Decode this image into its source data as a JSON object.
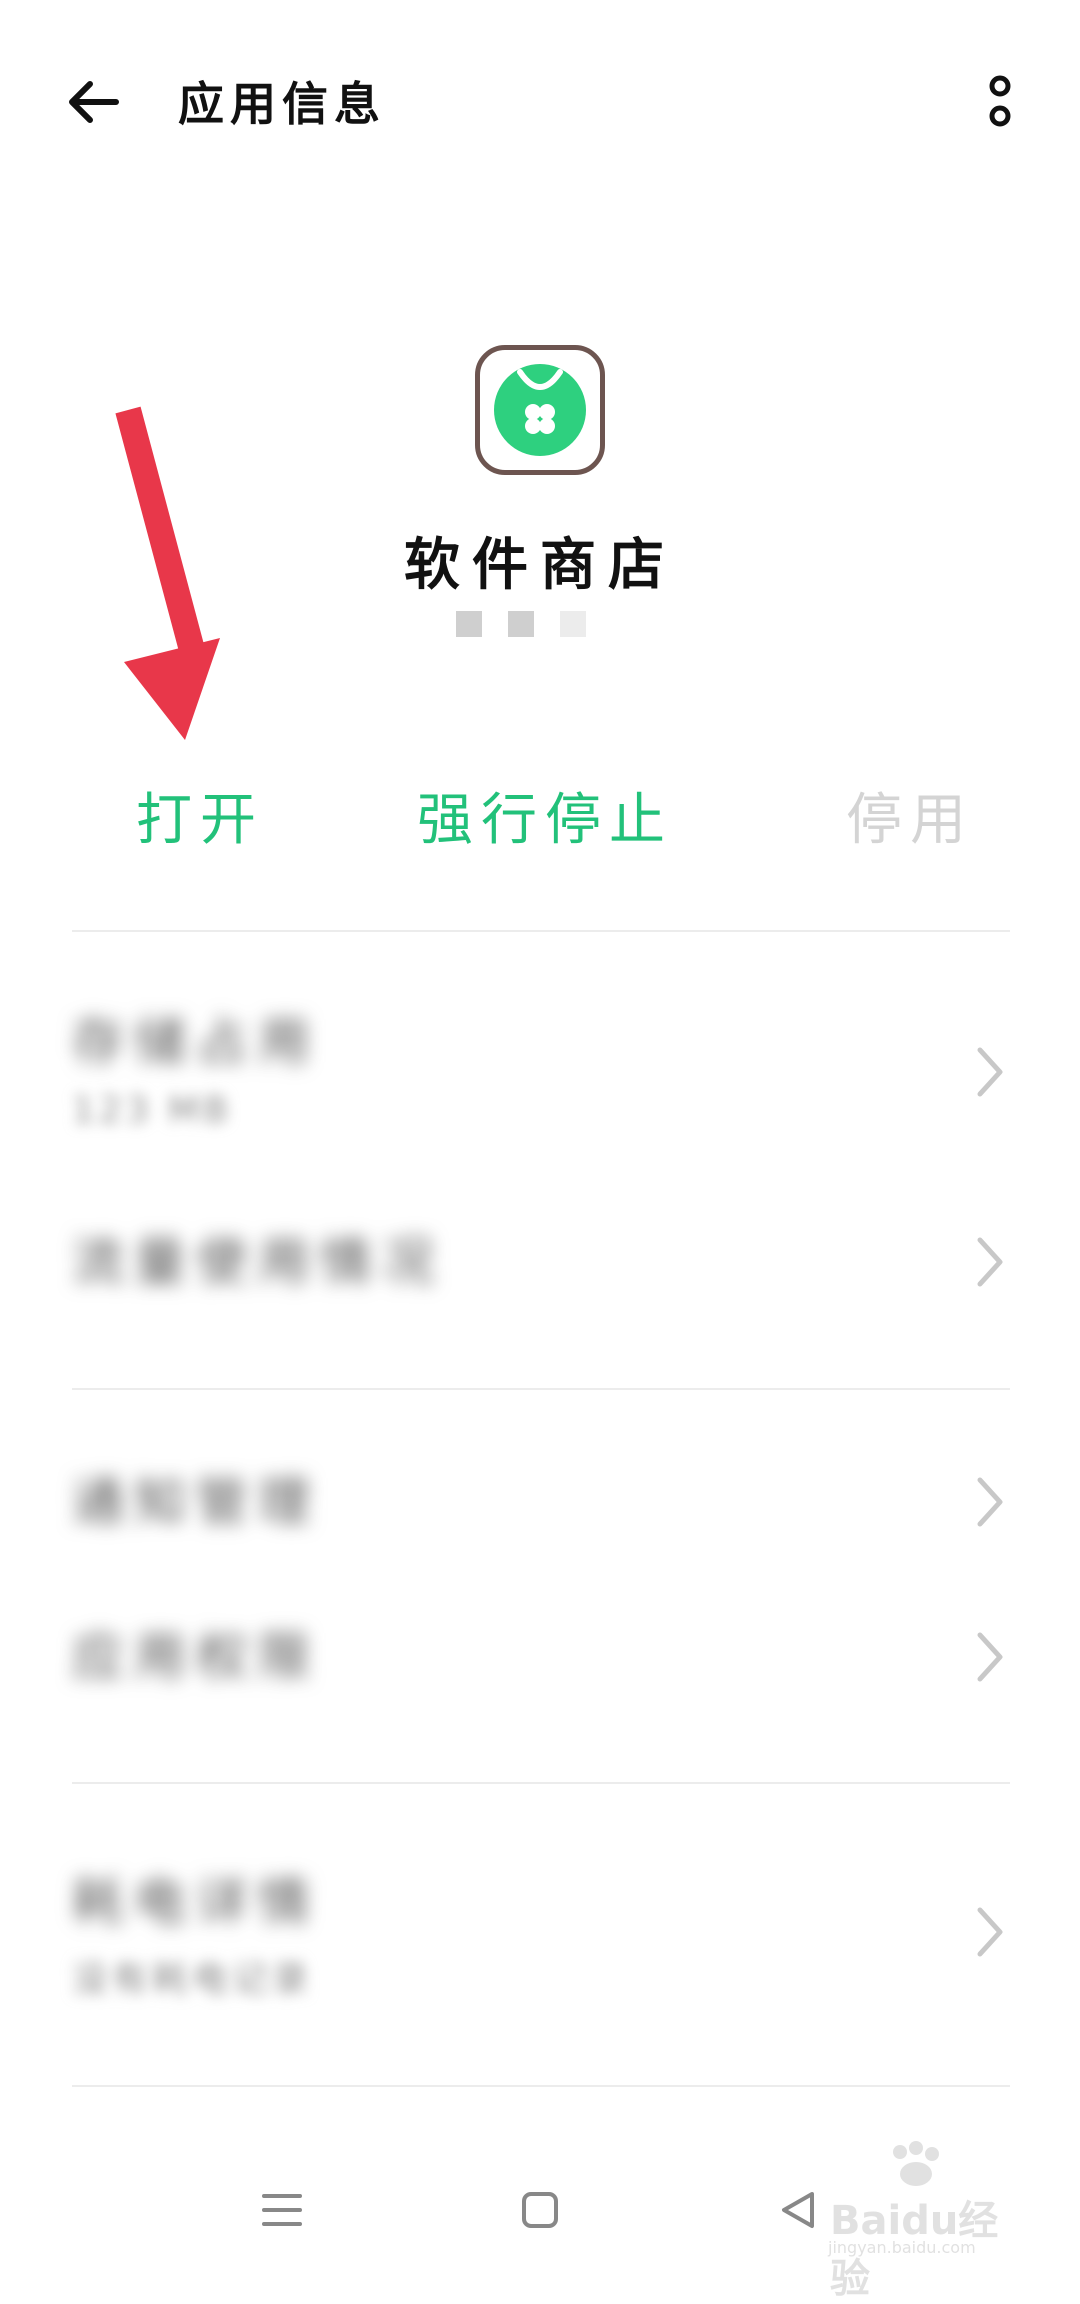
{
  "header": {
    "title": "应用信息",
    "back_icon": "arrow-left-icon",
    "more_icon": "more-vertical-icon"
  },
  "app": {
    "name": "软件商店",
    "icon": "software-store-icon",
    "icon_color": "#2ed07f",
    "icon_border_color": "#6d5550"
  },
  "actions": {
    "open": "打开",
    "force_stop": "强行停止",
    "disable": "停用",
    "accent_color": "#22c17a",
    "disabled_color": "#d4d4d4"
  },
  "annotation": {
    "arrow_color": "#e8374a"
  },
  "settings": {
    "rows": [
      {
        "title": "存储占用",
        "subtitle": "123 MB"
      },
      {
        "title": "流量使用情况",
        "subtitle": ""
      },
      {
        "title": "通知管理",
        "subtitle": ""
      },
      {
        "title": "应用权限",
        "subtitle": ""
      },
      {
        "title": "耗电详情",
        "subtitle": "没有耗电记录"
      }
    ]
  },
  "navigation": {
    "menu_icon": "menu-icon",
    "home_icon": "home-square-icon",
    "back_icon": "back-triangle-icon"
  },
  "watermark": {
    "brand": "Baidu经验",
    "url": "jingyan.baidu.com"
  }
}
